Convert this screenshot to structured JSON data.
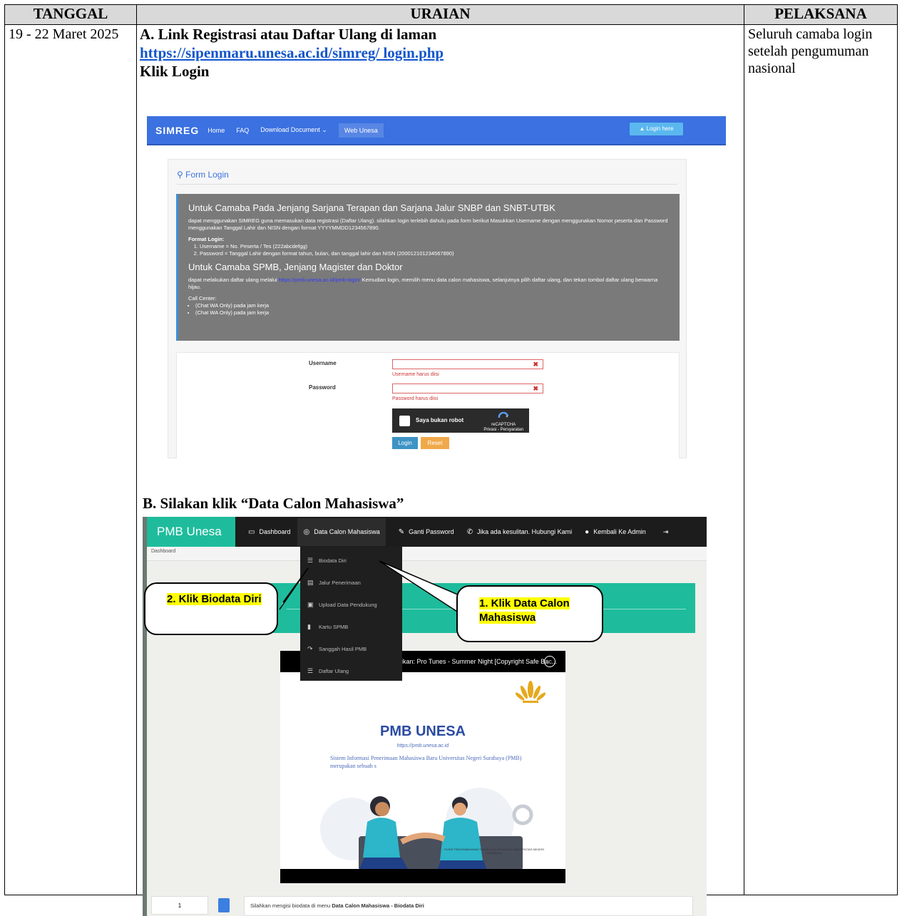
{
  "table": {
    "headers": {
      "date": "TANGGAL",
      "desc": "URAIAN",
      "exec": "PELAKSANA"
    },
    "row": {
      "date": "19 - 22 Maret 2025",
      "exec": "Seluruh camaba login setelah pengumuman nasional",
      "step_a": {
        "title": "A. Link Registrasi atau Daftar Ulang di laman",
        "link": "https://sipenmaru.unesa.ac.id/simreg/  login.php",
        "action": "Klik Login"
      },
      "step_b": {
        "title": "B. Silakan klik “Data Calon Mahasiswa”"
      }
    }
  },
  "simreg": {
    "brand": "SIMREG",
    "nav": [
      "Home",
      "FAQ",
      "Download Document ⌄",
      "Web Unesa"
    ],
    "login_here": "▲ Login here",
    "form_title": "⚲ Form Login",
    "info_h1": "Untuk Camaba Pada Jenjang Sarjana Terapan dan Sarjana Jalur SNBP dan SNBT-UTBK",
    "info_p1": "dapat menggunakan SIMREG guna memasukan data registrasi (Daftar Ulang). silahkan login terlebih dahulu pada form berikut Masukkan Username dengan menggunakan Nomor peserta dan Password menggunakan Tanggal Lahir dan NISN dengan format YYYYMMDD1234567890.",
    "format_label": "Format Login:",
    "format_items": [
      "Username = No. Peserta / Tes (222abcdefgg)",
      "Password = Tanggal Lahir dengan format tahun, bulan, dan tanggal lahir dan NISN (200012101234567890)"
    ],
    "info_h2": "Untuk Camaba SPMB, Jenjang Magister dan Doktor",
    "info_p2_pre": "dapat melakukan daftar ulang melalui ",
    "info_p2_link": "https://pmb.unesa.ac.id/pmb-login/",
    "info_p2_post": " Kemudian login, memilih menu data calon mahasiswa, selanjutnya pilih daftar ulang, dan tekan tombol daftar ulang berwarna hijau.",
    "call_center": "Call Center:",
    "cc_items": [
      "(Chat WA Only) pada jam kerja",
      "(Chat WA Only) pada jam kerja"
    ],
    "username_label": "Username",
    "username_error": "Username harus diisi",
    "password_label": "Password",
    "password_error": "Password harus diisi",
    "captcha_text": "Saya bukan robot",
    "captcha_brand": "reCAPTCHA",
    "captcha_links": "Privasi - Persyaratan",
    "login_btn": "Login",
    "reset_btn": "Reset"
  },
  "pmb": {
    "brand": "PMB Unesa",
    "nav": [
      "Dashboard",
      "Data Calon Mahasiswa",
      "Ganti Password",
      "Jika ada kesulitan. Hubungi Kami",
      "Kembali Ke Admin"
    ],
    "breadcrumb": "Dashboard",
    "dropdown": [
      "Biodata Diri",
      "Jalur Penerimaan",
      "Upload Data Pendukung",
      "Kartu SPMB",
      "Sanggah Hasil PMB",
      "Daftar Ulang"
    ],
    "video_title": "ikan: Pro Tunes - Summer Night [Copyright Safe Bac...",
    "slide_title": "PMB UNESA",
    "slide_url": "https://pmb.unesa.ac.id",
    "slide_desc": "Sistem Informasi Penerimaan Mahasiswa Baru Universitas Negeri Surabaya (PMB) merupakan sebuah s",
    "slide_footer": "PUSAT PENGEMBANGAN TEKNOLOGI INFORMASI UNIVERSITAS NEGERI SURABAYA",
    "page_number": "1",
    "message_pre": "Silahkan mengisi biodata di menu ",
    "message_bold": "Data Calon Mahasiswa - Biodata Diri",
    "callout_1": "1. Klik Data Calon Mahasiswa",
    "callout_2": "2. Klik Biodata Diri"
  }
}
